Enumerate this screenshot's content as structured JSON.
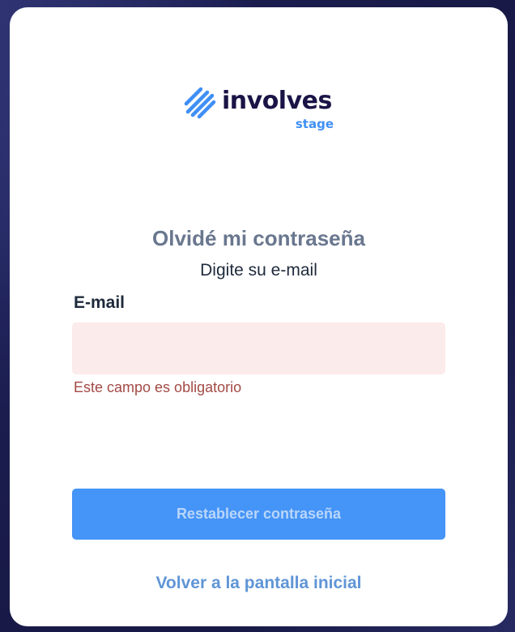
{
  "logo": {
    "wordmark": "involves",
    "sub": "stage",
    "icon": "involves-stripes-logo-icon",
    "colors": {
      "wordmark": "#1a1446",
      "accent": "#3f8ff5"
    }
  },
  "page": {
    "title": "Olvidé mi contraseña",
    "subtitle": "Digite su e-mail"
  },
  "form": {
    "email_label": "E-mail",
    "email_value": "",
    "email_placeholder": "",
    "error_message": "Este campo es obligatorio",
    "submit_label": "Restablecer contraseña"
  },
  "back_link": "Volver a la pantalla inicial",
  "colors": {
    "input_error_bg": "#fbebea",
    "error_text": "#a24a45",
    "button_bg": "#4594f7",
    "link": "#5f95d6"
  }
}
